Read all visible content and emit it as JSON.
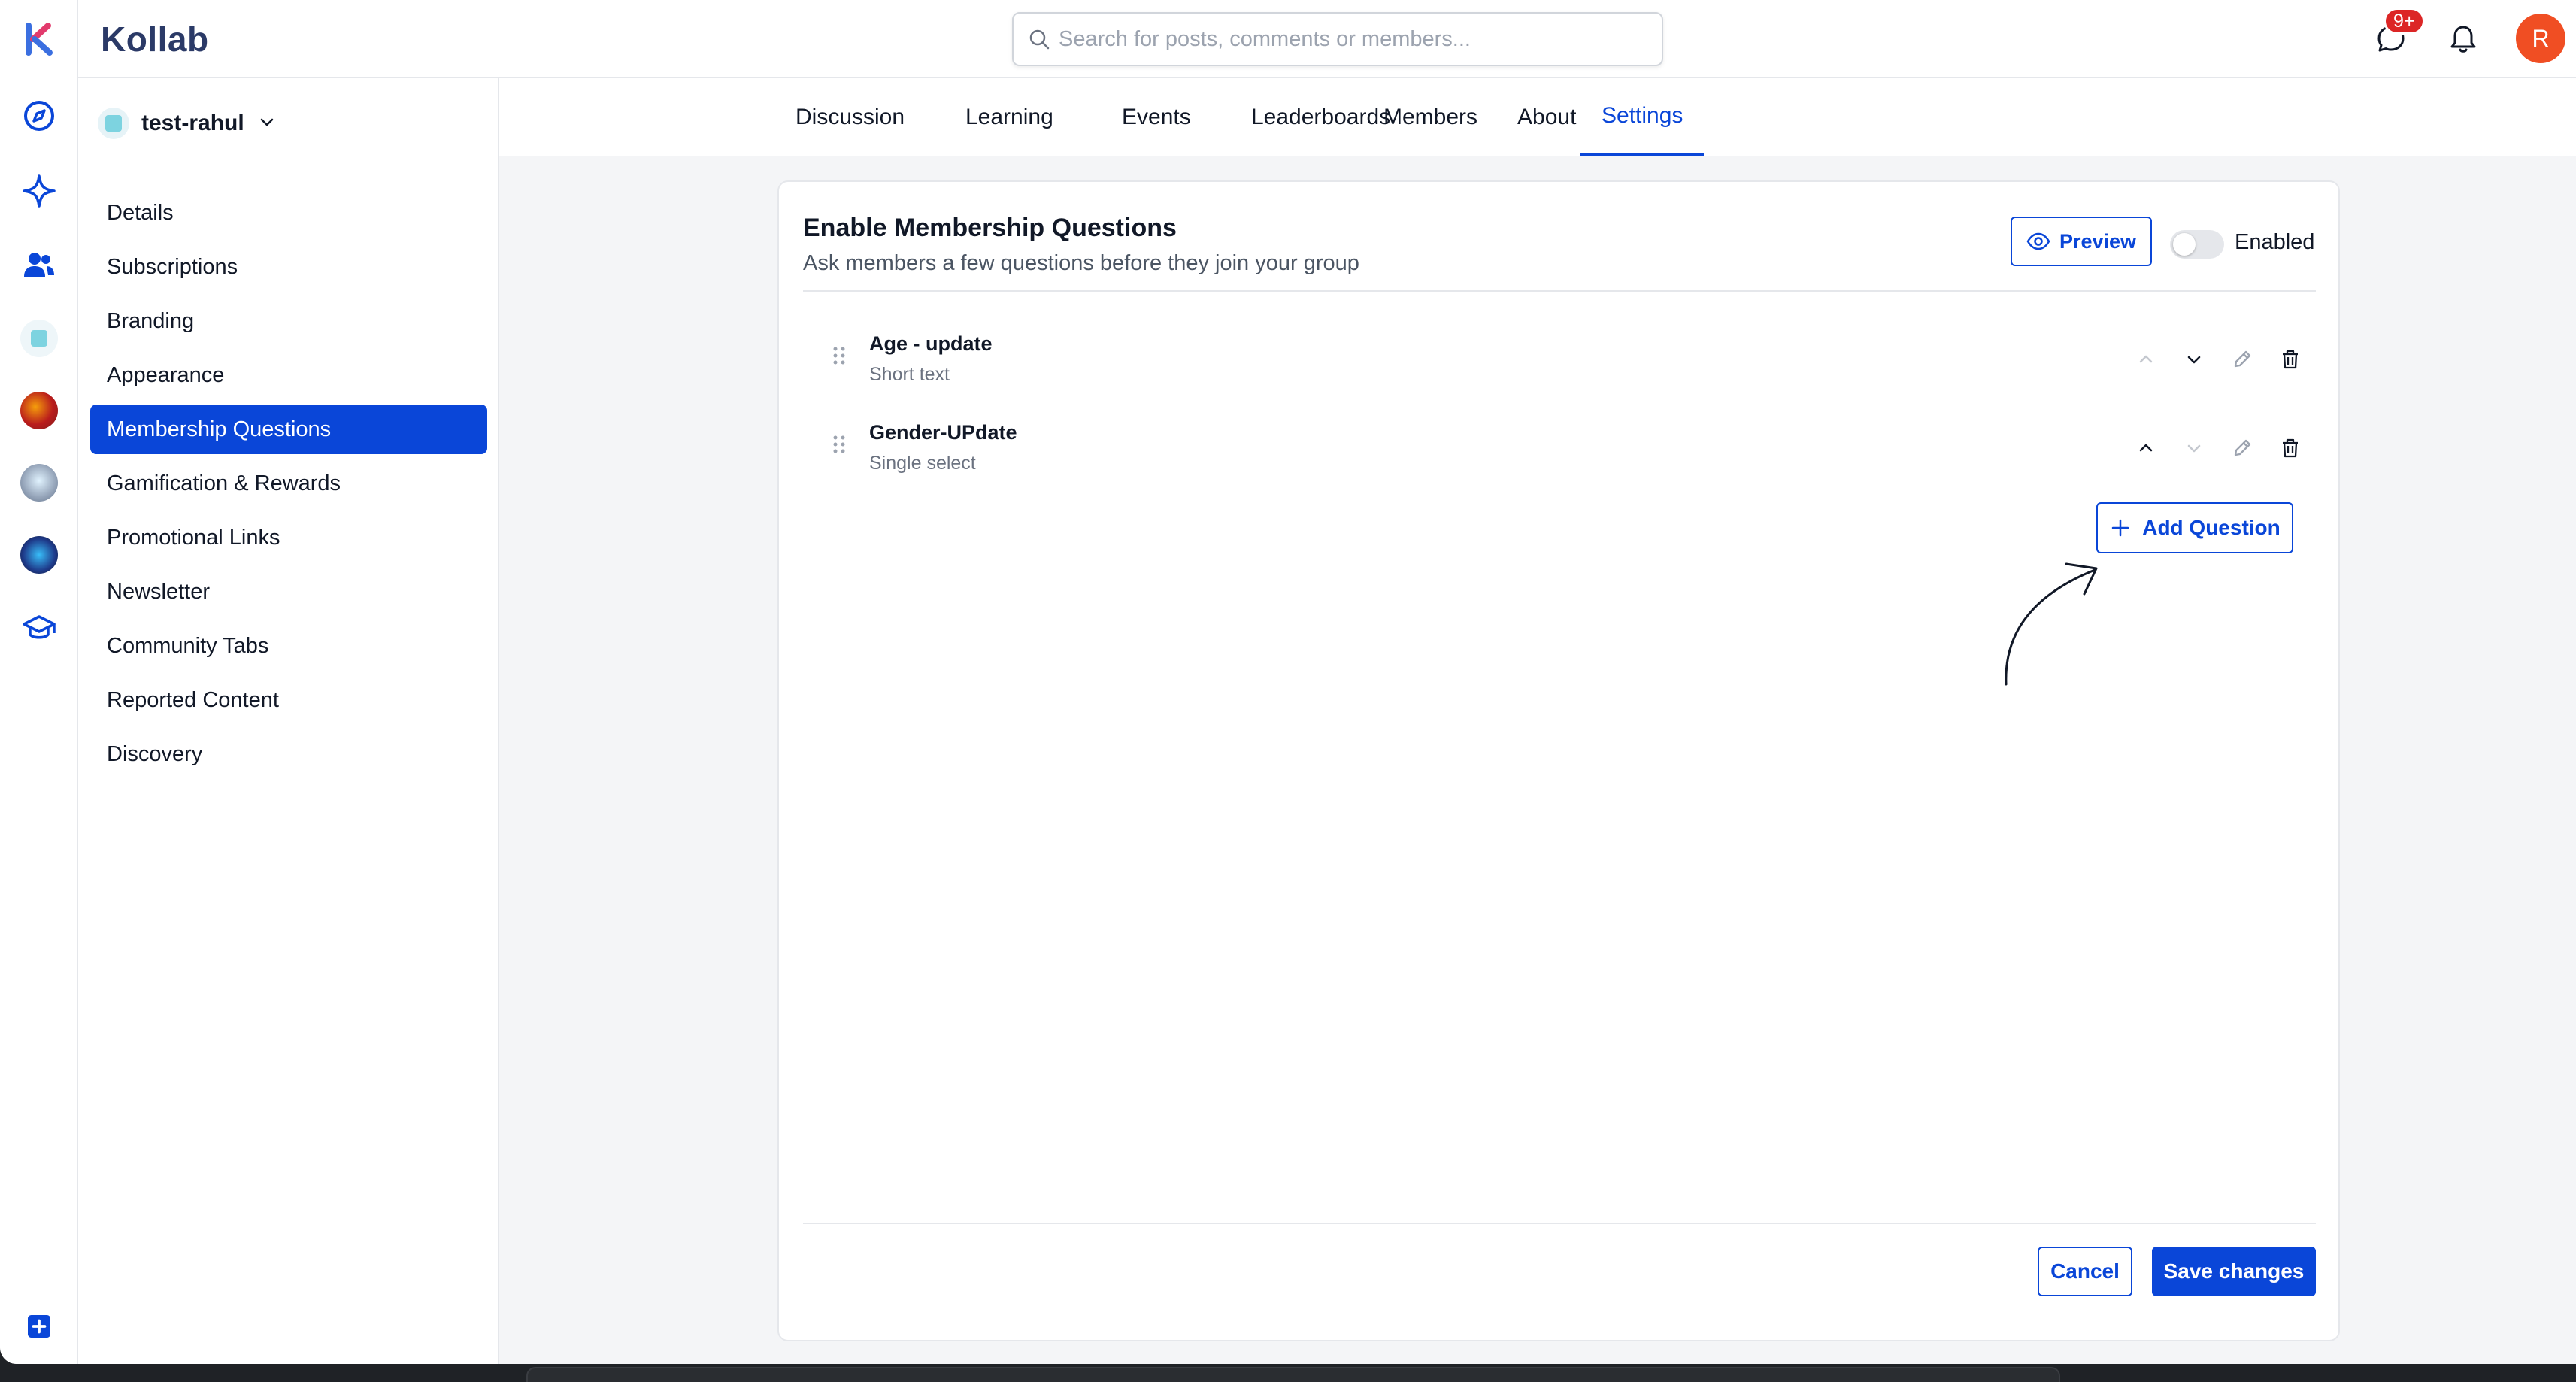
{
  "header": {
    "brand": "Kollab",
    "search_placeholder": "Search for posts, comments or members...",
    "notification_badge": "9+",
    "user_initial": "R"
  },
  "rail": {
    "icons": [
      "kollab-logo",
      "compass-icon",
      "sparkle-icon",
      "users-icon",
      "group-avatar",
      "group-avatar",
      "group-avatar",
      "group-avatar",
      "graduation-cap-icon",
      "add-icon"
    ]
  },
  "sidebar": {
    "group_name": "test-rahul",
    "items": [
      {
        "label": "Details"
      },
      {
        "label": "Subscriptions"
      },
      {
        "label": "Branding"
      },
      {
        "label": "Appearance"
      },
      {
        "label": "Membership Questions",
        "active": true
      },
      {
        "label": "Gamification & Rewards"
      },
      {
        "label": "Promotional Links"
      },
      {
        "label": "Newsletter"
      },
      {
        "label": "Community Tabs"
      },
      {
        "label": "Reported Content"
      },
      {
        "label": "Discovery"
      }
    ]
  },
  "tabs": [
    {
      "label": "Discussion"
    },
    {
      "label": "Learning"
    },
    {
      "label": "Events"
    },
    {
      "label": "Leaderboards"
    },
    {
      "label": "Members"
    },
    {
      "label": "About"
    },
    {
      "label": "Settings",
      "active": true
    }
  ],
  "card": {
    "title": "Enable Membership Questions",
    "subtitle": "Ask members a few questions before they join your group",
    "preview_label": "Preview",
    "toggle_label": "Enabled",
    "questions": [
      {
        "title": "Age - update",
        "type": "Short text"
      },
      {
        "title": "Gender-UPdate",
        "type": "Single select"
      }
    ],
    "add_question_label": "Add Question",
    "cancel_label": "Cancel",
    "save_label": "Save changes"
  },
  "colors": {
    "accent": "#0a46d8",
    "badge": "#dc2626",
    "avatar": "#f04e23"
  }
}
